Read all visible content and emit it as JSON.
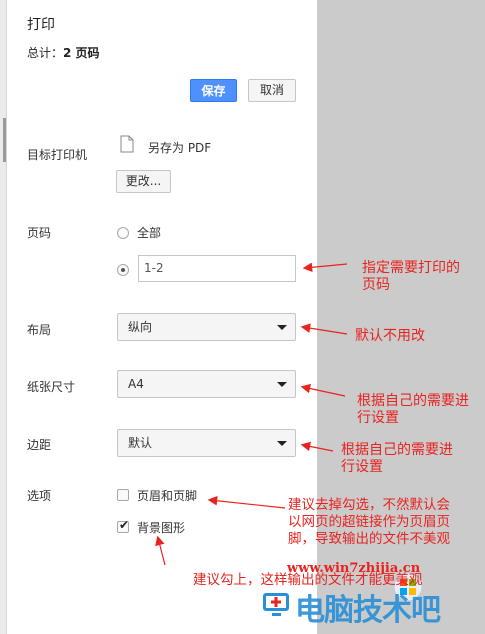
{
  "header": {
    "title": "打印",
    "total_prefix": "总计：",
    "total_value": "2 页码"
  },
  "actions": {
    "save_label": "保存",
    "cancel_label": "取消"
  },
  "destination": {
    "label": "目标打印机",
    "printer_name": "另存为 PDF",
    "change_label": "更改..."
  },
  "pages": {
    "label": "页码",
    "all_label": "全部",
    "custom_value": "1-2"
  },
  "layout": {
    "label": "布局",
    "value": "纵向"
  },
  "paper_size": {
    "label": "纸张尺寸",
    "value": "A4"
  },
  "margins": {
    "label": "边距",
    "value": "默认"
  },
  "options": {
    "label": "选项",
    "headers_footers_label": "页眉和页脚",
    "headers_footers_checked": false,
    "background_label": "背景图形",
    "background_checked": true
  },
  "annotations": {
    "pages_note_1": "指定需要打印的",
    "pages_note_2": "页码",
    "layout_note": "默认不用改",
    "paper_note_1": "根据自己的需要进",
    "paper_note_2": "行设置",
    "margins_note_1": "根据自己的需要进",
    "margins_note_2": "行设置",
    "headers_note_1": "建议去掉勾选，不然默认会",
    "headers_note_2": "以网页的超链接作为页眉页",
    "headers_note_3": "脚，导致输出的文件不美观",
    "background_note": "建议勾上，这样输出的文件才能更美观",
    "color": "#e8231f"
  },
  "watermark": {
    "url": "www.win7zhijia.cn",
    "brand": "电脑技术吧"
  }
}
